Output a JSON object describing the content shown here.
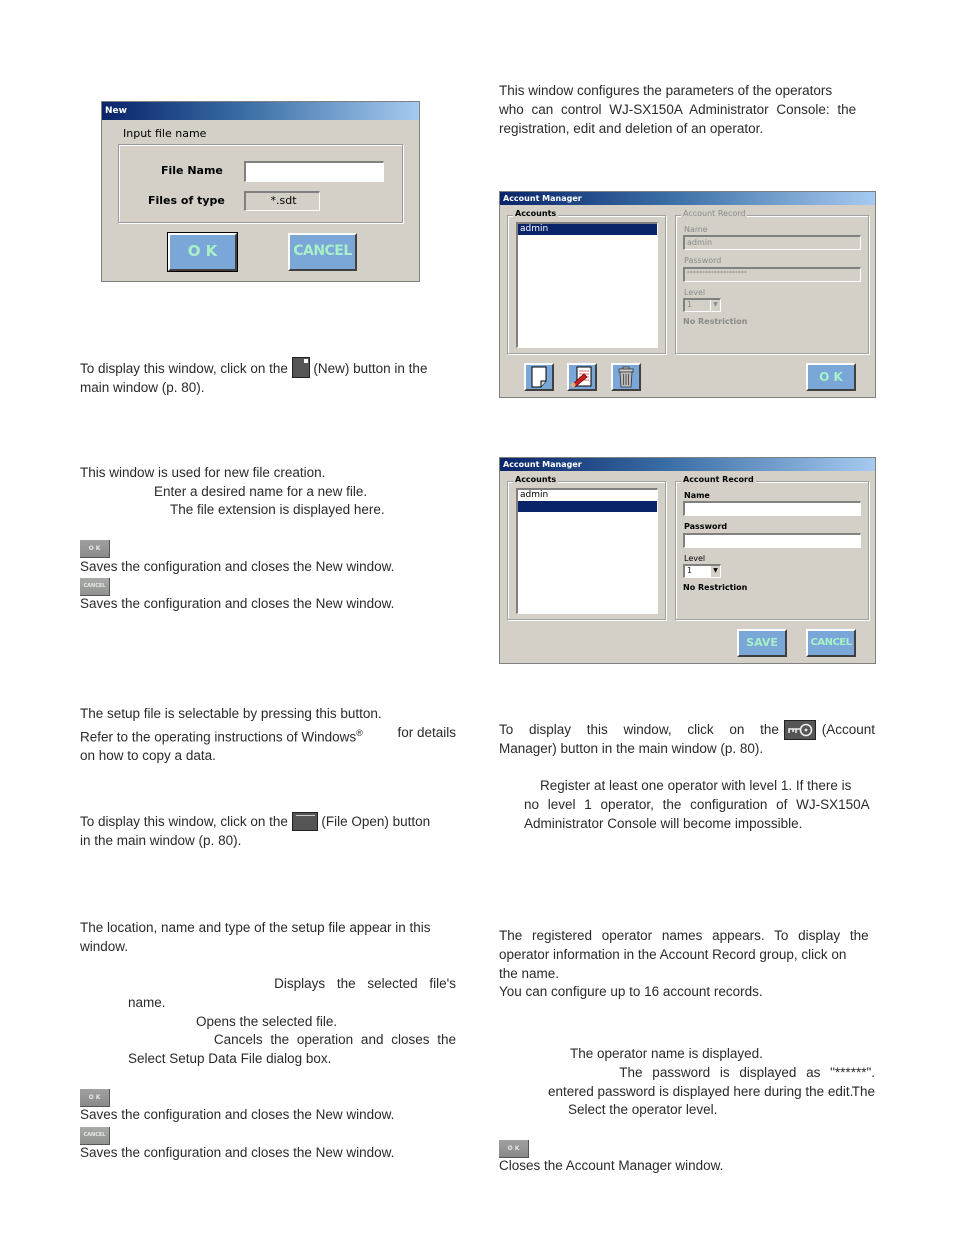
{
  "new_dialog": {
    "title": "New",
    "group_label": "Input file name",
    "file_name_label": "File Name",
    "file_name_value": "",
    "files_of_type_label": "Files of type",
    "files_of_type_value": "*.sdt",
    "ok_label": "O K",
    "cancel_label": "CANCEL"
  },
  "left_column": {
    "new_open_text_before": "To display this window, click on the",
    "new_open_text_after": "(New) button in the",
    "new_open_text_line2": "main window (p. 80).",
    "new_icon": "new-file-icon",
    "new_desc": "This window is used for new file creation.",
    "file_name_desc": "Enter a desired name for a new file.",
    "files_of_type_desc": "The file extension is displayed here.",
    "ok_mini_label": "O K",
    "ok_desc": "Saves the configuration and closes the New window.",
    "cancel_mini_label": "CANCEL",
    "cancel_desc": "Saves the configuration and closes the New window.",
    "setup_file_line1": "The setup file is selectable by pressing this button.",
    "setup_file_line2a": "Refer to the operating instructions of Windows",
    "setup_file_line2_reg": "®",
    "setup_file_line2b": " for details",
    "setup_file_line3": "on how to copy a data.",
    "open_text_before": "To display this window, click on the",
    "open_text_after": "(File Open) button",
    "open_text_line2": "in the main window (p. 80).",
    "open_icon": "folder-icon",
    "location_line1": "The location, name and type of the setup file appear in this",
    "location_line2": "window.",
    "displays_desc": "Displays the selected file's",
    "displays_desc2": "name.",
    "opens_desc": "Opens the selected file.",
    "cancels_desc": "Cancels the operation and closes the",
    "cancels_desc2": "Select Setup Data File dialog box.",
    "ok2_mini_label": "O K",
    "ok2_desc": "Saves the configuration and closes the New window.",
    "cancel2_mini_label": "CANCEL",
    "cancel2_desc": "Saves the configuration and closes the New window."
  },
  "right_column": {
    "intro_line1": "This window configures the parameters of the operators",
    "intro_line2": "who can control WJ-SX150A Administrator Console: the",
    "intro_line3": "registration, edit and deletion of an operator.",
    "display_text_before": "To display this window, click on the",
    "display_text_after": "(Account",
    "display_text_line2": "Manager) button in the main window (p. 80).",
    "account_icon": "key-icon",
    "note_line1": "Register at least one operator with level 1. If there is",
    "note_line2": "no level 1 operator, the configuration of WJ-SX150A",
    "note_line3": "Administrator Console will become impossible.",
    "accounts_desc_line1": "The registered operator names appears. To display the",
    "accounts_desc_line2": "operator information in the Account Record group, click on",
    "accounts_desc_line3": "the name.",
    "accounts_desc_line4": "You can configure up to 16 account records.",
    "name_desc": "The operator name is displayed.",
    "password_desc1": "The password is displayed as \"******\". The",
    "password_desc2": "entered password is displayed here during the edit.",
    "level_desc": "Select the operator level.",
    "ok_mini_label": "O K",
    "ok_desc": "Closes the Account Manager window."
  },
  "account_manager_view": {
    "title": "Account Manager",
    "accounts_label": "Accounts",
    "accounts": [
      {
        "name": "admin",
        "selected": true
      }
    ],
    "record_label": "Account Record",
    "name_label": "Name",
    "name_value": "admin",
    "password_label": "Password",
    "password_value": "********************",
    "level_label": "Level",
    "level_value": "1",
    "restriction": "No Restriction",
    "ok_label": "O K",
    "toolbar": [
      "new-account-icon",
      "edit-account-icon",
      "delete-account-icon"
    ]
  },
  "account_manager_edit": {
    "title": "Account Manager",
    "accounts_label": "Accounts",
    "accounts": [
      {
        "name": "admin",
        "selected": false
      },
      {
        "name": "",
        "selected": true
      }
    ],
    "record_label": "Account Record",
    "name_label": "Name",
    "name_value": "",
    "password_label": "Password",
    "password_value": "",
    "level_label": "Level",
    "level_value": "1",
    "restriction": "No Restriction",
    "save_label": "SAVE",
    "cancel_label": "CANCEL"
  }
}
